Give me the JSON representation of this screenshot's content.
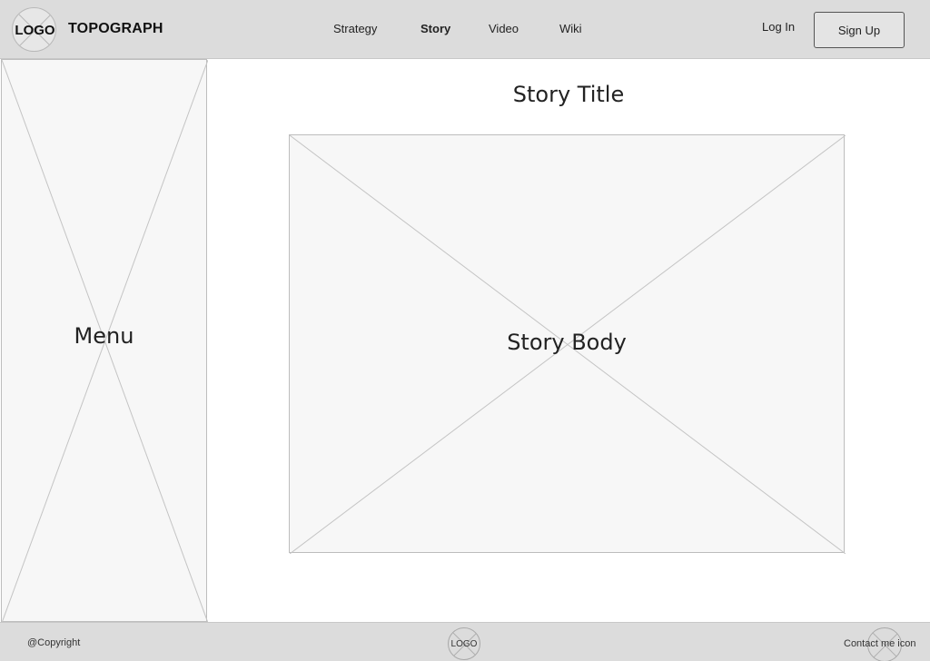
{
  "header": {
    "logo_text": "LOGO",
    "brand": "TOPOGRAPH",
    "nav": [
      {
        "label": "Strategy",
        "active": false
      },
      {
        "label": "Story",
        "active": true
      },
      {
        "label": "Video",
        "active": false
      },
      {
        "label": "Wiki",
        "active": false
      }
    ],
    "login_label": "Log In",
    "signup_label": "Sign Up"
  },
  "sidebar": {
    "label": "Menu"
  },
  "main": {
    "title": "Story Title",
    "body_label": "Story Body"
  },
  "footer": {
    "copyright": "@Copyright",
    "logo_text": "LOGO",
    "contact_label": "Contact me icon"
  },
  "colors": {
    "header_bg": "#dcdcdc",
    "placeholder_bg": "#f7f7f7",
    "placeholder_border": "#bdbdbd"
  }
}
